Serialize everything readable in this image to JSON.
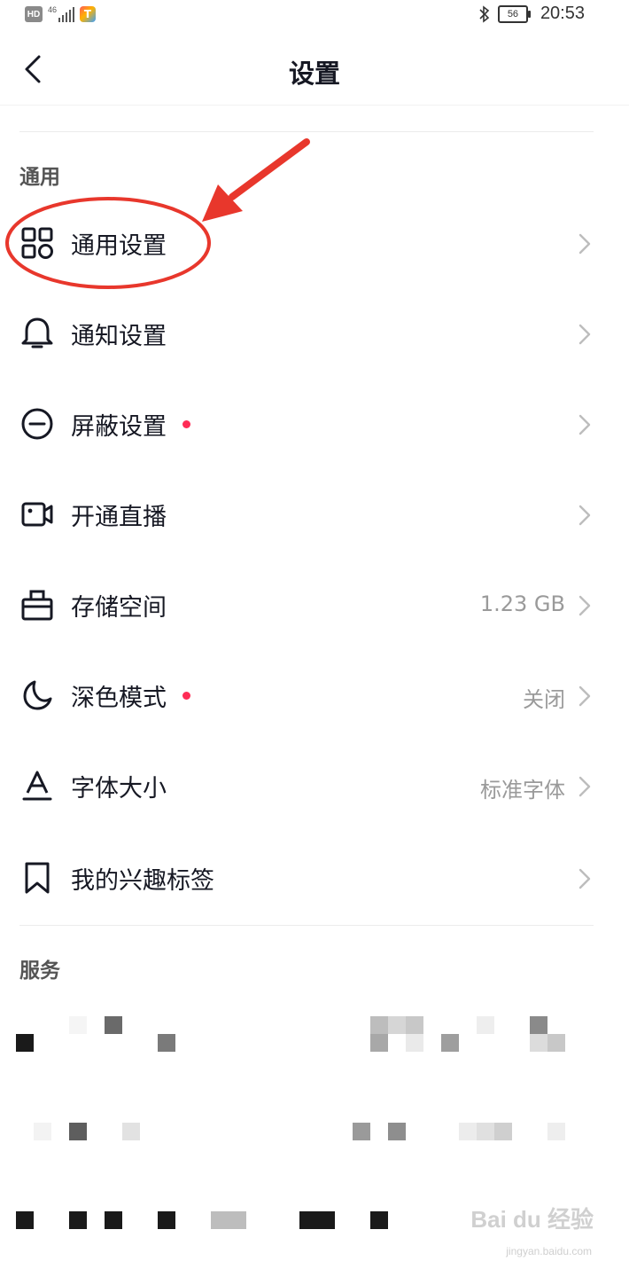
{
  "status_bar": {
    "hd": "HD",
    "network": "46",
    "time": "20:53",
    "battery": "56"
  },
  "nav": {
    "title": "设置"
  },
  "sections": {
    "general": "通用",
    "services": "服务"
  },
  "items": [
    {
      "label": "通用设置",
      "icon": "grid-icon",
      "value": "",
      "dot": false
    },
    {
      "label": "通知设置",
      "icon": "bell-icon",
      "value": "",
      "dot": false
    },
    {
      "label": "屏蔽设置",
      "icon": "block-icon",
      "value": "",
      "dot": true
    },
    {
      "label": "开通直播",
      "icon": "video-camera-icon",
      "value": "",
      "dot": false
    },
    {
      "label": "存储空间",
      "icon": "storage-box-icon",
      "value": "1.23 GB",
      "dot": false
    },
    {
      "label": "深色模式",
      "icon": "moon-icon",
      "value": "关闭",
      "dot": true
    },
    {
      "label": "字体大小",
      "icon": "font-size-icon",
      "value": "标准字体",
      "dot": false
    },
    {
      "label": "我的兴趣标签",
      "icon": "bookmark-icon",
      "value": "",
      "dot": false
    }
  ],
  "colors": {
    "accent_dot": "#fe2c55",
    "annotation_red": "#e8372c"
  },
  "watermark": {
    "brand": "Bai du 经验",
    "url": "jingyan.baidu.com"
  }
}
